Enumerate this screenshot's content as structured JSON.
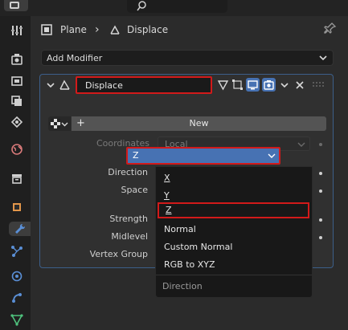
{
  "breadcrumb": {
    "object": "Plane",
    "separator": "›",
    "modifier": "Displace"
  },
  "add_modifier": {
    "label": "Add Modifier"
  },
  "modifier": {
    "name": "Displace",
    "texture_new_label": "New",
    "coordinates": {
      "label": "Coordinates",
      "value": "Local"
    },
    "direction": {
      "label": "Direction",
      "value": "Z"
    },
    "space": {
      "label": "Space"
    },
    "strength": {
      "label": "Strength"
    },
    "midlevel": {
      "label": "Midlevel"
    },
    "vertex_group": {
      "label": "Vertex Group"
    }
  },
  "direction_menu": {
    "options": [
      "X",
      "Y",
      "Z",
      "Normal",
      "Custom Normal",
      "RGB to XYZ"
    ],
    "selected": "Z",
    "footer": "Direction"
  },
  "colors": {
    "accent_blue": "#4772b3",
    "highlight_red": "#d21a1a",
    "panel_border": "#3c5f8a",
    "modifier_icon_blue": "#5a8fd6"
  },
  "icons": {
    "tabs": [
      "tool-icon",
      "render-icon",
      "output-icon",
      "view-layer-icon",
      "scene-icon",
      "world-icon",
      "collection-icon",
      "object-icon",
      "modifier-icon",
      "particles-icon",
      "physics-icon",
      "constraints-icon",
      "data-icon"
    ]
  }
}
